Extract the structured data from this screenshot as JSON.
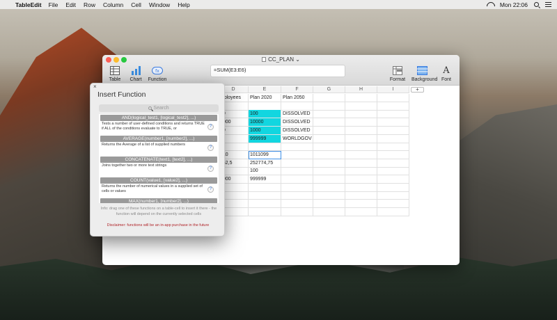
{
  "menubar": {
    "app": "TableEdit",
    "items": [
      "File",
      "Edit",
      "Row",
      "Column",
      "Cell",
      "Window",
      "Help"
    ],
    "clock": "Mon 22:06"
  },
  "window": {
    "title": "CC_PLAN",
    "toolbar": {
      "table": "Table",
      "chart": "Chart",
      "function": "Function",
      "format": "Format",
      "background": "Background",
      "font": "Font"
    },
    "formula": "=SUM(E3:E6)",
    "add_column": "+",
    "columns": [
      "D",
      "E",
      "F",
      "G",
      "H",
      "I"
    ],
    "rows": [
      [
        "mployees",
        "Plan 2020",
        "Plan 2050",
        "",
        "",
        ""
      ],
      [
        "",
        "",
        "",
        "",
        "",
        ""
      ],
      [
        "00",
        "100",
        "DISSOLVED",
        "",
        "",
        ""
      ],
      [
        "0000",
        "10000",
        "DISSOLVED",
        "",
        "",
        ""
      ],
      [
        "00",
        "1000",
        "DISSOLVED",
        "",
        "",
        ""
      ],
      [
        "",
        "999999",
        "WORLDGOV",
        "",
        "",
        ""
      ],
      [
        "",
        "",
        "",
        "",
        "",
        ""
      ],
      [
        "010",
        "1011099",
        "",
        "",
        "",
        ""
      ],
      [
        "752,5",
        "252774,75",
        "",
        "",
        "",
        ""
      ],
      [
        "",
        "100",
        "",
        "",
        "",
        ""
      ],
      [
        "0000",
        "999999",
        "",
        "",
        "",
        ""
      ],
      [
        "",
        "",
        "",
        "",
        "",
        ""
      ],
      [
        "",
        "",
        "",
        "",
        "",
        ""
      ],
      [
        "",
        "",
        "",
        "",
        "",
        ""
      ],
      [
        "",
        "",
        "",
        "",
        "",
        ""
      ]
    ],
    "highlight_color": "#12d6e0"
  },
  "panel": {
    "close": "×",
    "title": "Insert Function",
    "search_placeholder": "Search",
    "functions": [
      {
        "name": "AND(logical_test1, [logical_test2], ...)",
        "desc": "Tests a number of user-defined conditions and returns TRUE if ALL of the conditions evaluate to TRUE, or"
      },
      {
        "name": "AVERAGE(number1, [number2], ...)",
        "desc": "Returns the Average of a list of supplied numbers"
      },
      {
        "name": "CONCATENATE(text1, [text2], ...)",
        "desc": "Joins together two or more text strings"
      },
      {
        "name": "COUNT(value1, [value2], ...)",
        "desc": "Returns the number of numerical values in a supplied set of cells or values"
      },
      {
        "name": "MAX(number1, [number2], ...)",
        "desc": ""
      }
    ],
    "help_glyph": "?",
    "info": "Info: drag one of these functions on a table-cell to insert it there - the function will depend on the currently selected cells",
    "disclaimer": "Disclaimer: functions will be an in-app purchase in the future"
  }
}
